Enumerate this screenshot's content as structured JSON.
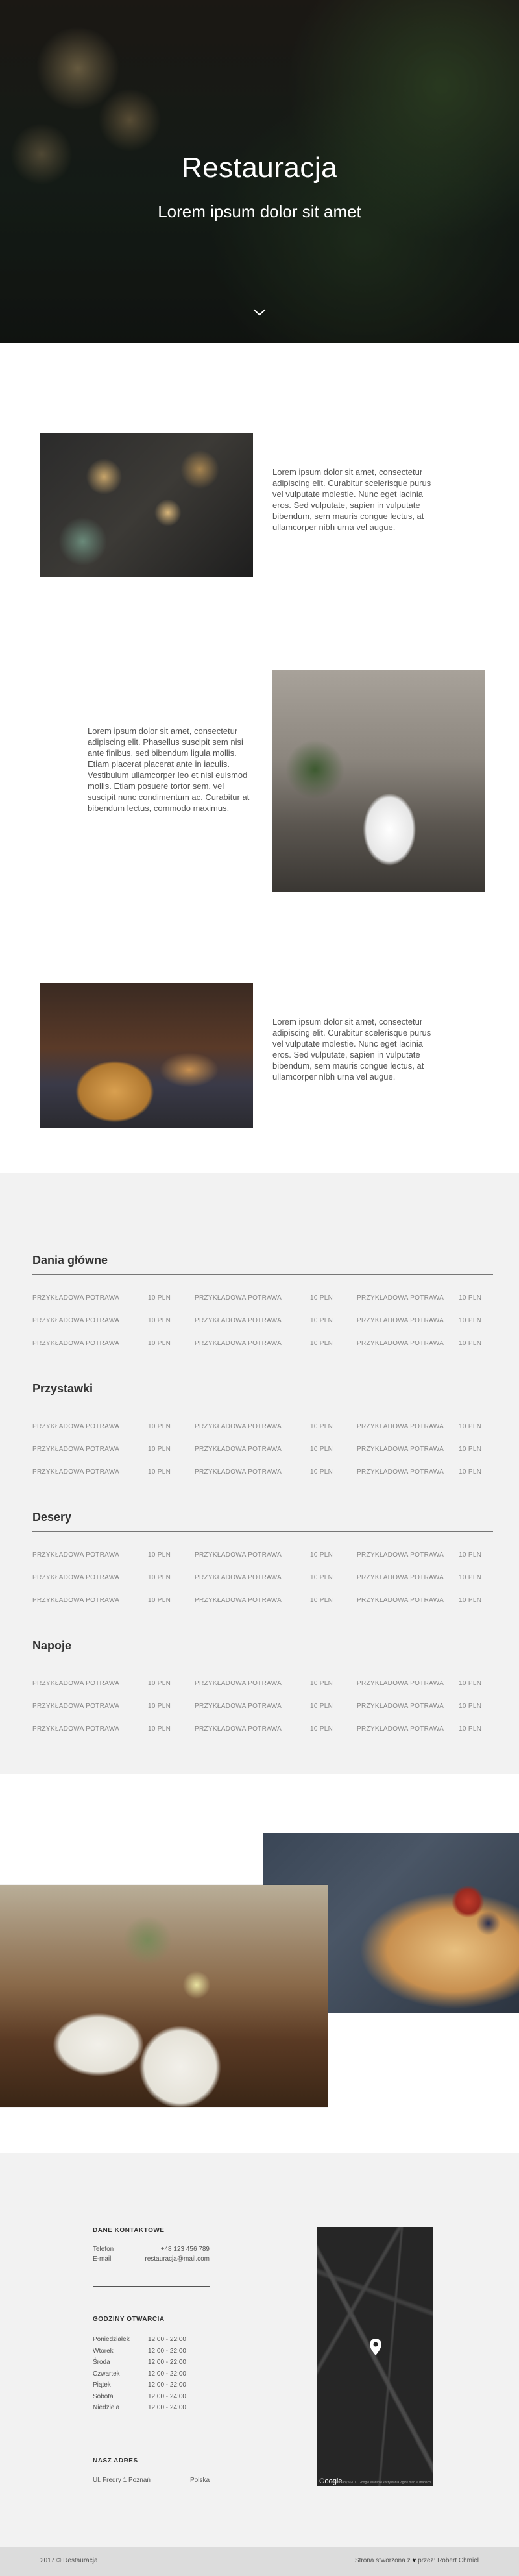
{
  "hero": {
    "title": "Restauracja",
    "subtitle": "Lorem ipsum dolor sit amet",
    "scroll_icon": "chevron-down-icon"
  },
  "about": [
    {
      "text": "Lorem ipsum dolor sit amet, consectetur adipiscing elit. Curabitur scelerisque purus vel vulputate molestie. Nunc eget lacinia eros. Sed vulputate, sapien in vulputate bibendum, sem mauris congue lectus, at ullamcorper nibh urna vel augue."
    },
    {
      "text": "Lorem ipsum dolor sit amet, consectetur adipiscing elit. Phasellus suscipit sem nisi ante finibus, sed bibendum ligula mollis. Etiam placerat placerat ante in iaculis. Vestibulum ullamcorper leo et nisl euismod mollis. Etiam posuere tortor sem, vel suscipit nunc condimentum ac. Curabitur at bibendum lectus, commodo maximus."
    },
    {
      "text": "Lorem ipsum dolor sit amet, consectetur adipiscing elit. Curabitur scelerisque purus vel vulputate molestie. Nunc eget lacinia eros. Sed vulputate, sapien in vulputate bibendum, sem mauris congue lectus, at ullamcorper nibh urna vel augue."
    }
  ],
  "menu": {
    "categories": [
      {
        "title": "Dania główne",
        "rows": [
          [
            {
              "name": "PRZYKŁADOWA POTRAWA",
              "price": "10 PLN"
            },
            {
              "name": "PRZYKŁADOWA POTRAWA",
              "price": "10 PLN"
            },
            {
              "name": "PRZYKŁADOWA POTRAWA",
              "price": "10 PLN"
            }
          ],
          [
            {
              "name": "PRZYKŁADOWA POTRAWA",
              "price": "10 PLN"
            },
            {
              "name": "PRZYKŁADOWA POTRAWA",
              "price": "10 PLN"
            },
            {
              "name": "PRZYKŁADOWA POTRAWA",
              "price": "10 PLN"
            }
          ],
          [
            {
              "name": "PRZYKŁADOWA POTRAWA",
              "price": "10 PLN"
            },
            {
              "name": "PRZYKŁADOWA POTRAWA",
              "price": "10 PLN"
            },
            {
              "name": "PRZYKŁADOWA POTRAWA",
              "price": "10 PLN"
            }
          ]
        ]
      },
      {
        "title": "Przystawki",
        "rows": [
          [
            {
              "name": "PRZYKŁADOWA POTRAWA",
              "price": "10 PLN"
            },
            {
              "name": "PRZYKŁADOWA POTRAWA",
              "price": "10 PLN"
            },
            {
              "name": "PRZYKŁADOWA POTRAWA",
              "price": "10 PLN"
            }
          ],
          [
            {
              "name": "PRZYKŁADOWA POTRAWA",
              "price": "10 PLN"
            },
            {
              "name": "PRZYKŁADOWA POTRAWA",
              "price": "10 PLN"
            },
            {
              "name": "PRZYKŁADOWA POTRAWA",
              "price": "10 PLN"
            }
          ],
          [
            {
              "name": "PRZYKŁADOWA POTRAWA",
              "price": "10 PLN"
            },
            {
              "name": "PRZYKŁADOWA POTRAWA",
              "price": "10 PLN"
            },
            {
              "name": "PRZYKŁADOWA POTRAWA",
              "price": "10 PLN"
            }
          ]
        ]
      },
      {
        "title": "Desery",
        "rows": [
          [
            {
              "name": "PRZYKŁADOWA POTRAWA",
              "price": "10 PLN"
            },
            {
              "name": "PRZYKŁADOWA POTRAWA",
              "price": "10 PLN"
            },
            {
              "name": "PRZYKŁADOWA POTRAWA",
              "price": "10 PLN"
            }
          ],
          [
            {
              "name": "PRZYKŁADOWA POTRAWA",
              "price": "10 PLN"
            },
            {
              "name": "PRZYKŁADOWA POTRAWA",
              "price": "10 PLN"
            },
            {
              "name": "PRZYKŁADOWA POTRAWA",
              "price": "10 PLN"
            }
          ],
          [
            {
              "name": "PRZYKŁADOWA POTRAWA",
              "price": "10 PLN"
            },
            {
              "name": "PRZYKŁADOWA POTRAWA",
              "price": "10 PLN"
            },
            {
              "name": "PRZYKŁADOWA POTRAWA",
              "price": "10 PLN"
            }
          ]
        ]
      },
      {
        "title": "Napoje",
        "rows": [
          [
            {
              "name": "PRZYKŁADOWA POTRAWA",
              "price": "10 PLN"
            },
            {
              "name": "PRZYKŁADOWA POTRAWA",
              "price": "10 PLN"
            },
            {
              "name": "PRZYKŁADOWA POTRAWA",
              "price": "10 PLN"
            }
          ],
          [
            {
              "name": "PRZYKŁADOWA POTRAWA",
              "price": "10 PLN"
            },
            {
              "name": "PRZYKŁADOWA POTRAWA",
              "price": "10 PLN"
            },
            {
              "name": "PRZYKŁADOWA POTRAWA",
              "price": "10 PLN"
            }
          ],
          [
            {
              "name": "PRZYKŁADOWA POTRAWA",
              "price": "10 PLN"
            },
            {
              "name": "PRZYKŁADOWA POTRAWA",
              "price": "10 PLN"
            },
            {
              "name": "PRZYKŁADOWA POTRAWA",
              "price": "10 PLN"
            }
          ]
        ]
      }
    ]
  },
  "contact": {
    "contact_heading": "DANE KONTAKTOWE",
    "phone_label": "Telefon",
    "phone_value": "+48 123 456 789",
    "email_label": "E-mail",
    "email_value": "restauracja@mail.com",
    "hours_heading": "GODZINY OTWARCIA",
    "hours": [
      {
        "day": "Poniedziałek",
        "time": "12:00 - 22:00"
      },
      {
        "day": "Wtorek",
        "time": "12:00 - 22:00"
      },
      {
        "day": "Środa",
        "time": "12:00 - 22:00"
      },
      {
        "day": "Czwartek",
        "time": "12:00 - 22:00"
      },
      {
        "day": "Piątek",
        "time": "12:00 - 22:00"
      },
      {
        "day": "Sobota",
        "time": "12:00 - 24:00"
      },
      {
        "day": "Niedziela",
        "time": "12:00 - 24:00"
      }
    ],
    "address_heading": "NASZ ADRES",
    "address_street": "Ul. Fredry 1 Poznań",
    "address_country": "Polska",
    "map_logo": "Google",
    "map_attribution": "Dane mapy ©2017 Google   Warunki korzystania   Zgłoś błąd w mapach"
  },
  "footer": {
    "left": "2017 © Restauracja",
    "right_prefix": "Strona stworzona z",
    "right_suffix": "przez: Robert Chmiel",
    "heart_icon": "heart-icon"
  },
  "colors": {
    "menu_bg": "#f2f2f2",
    "footer_bg": "#dcdcdc",
    "map_bg": "#262626"
  }
}
